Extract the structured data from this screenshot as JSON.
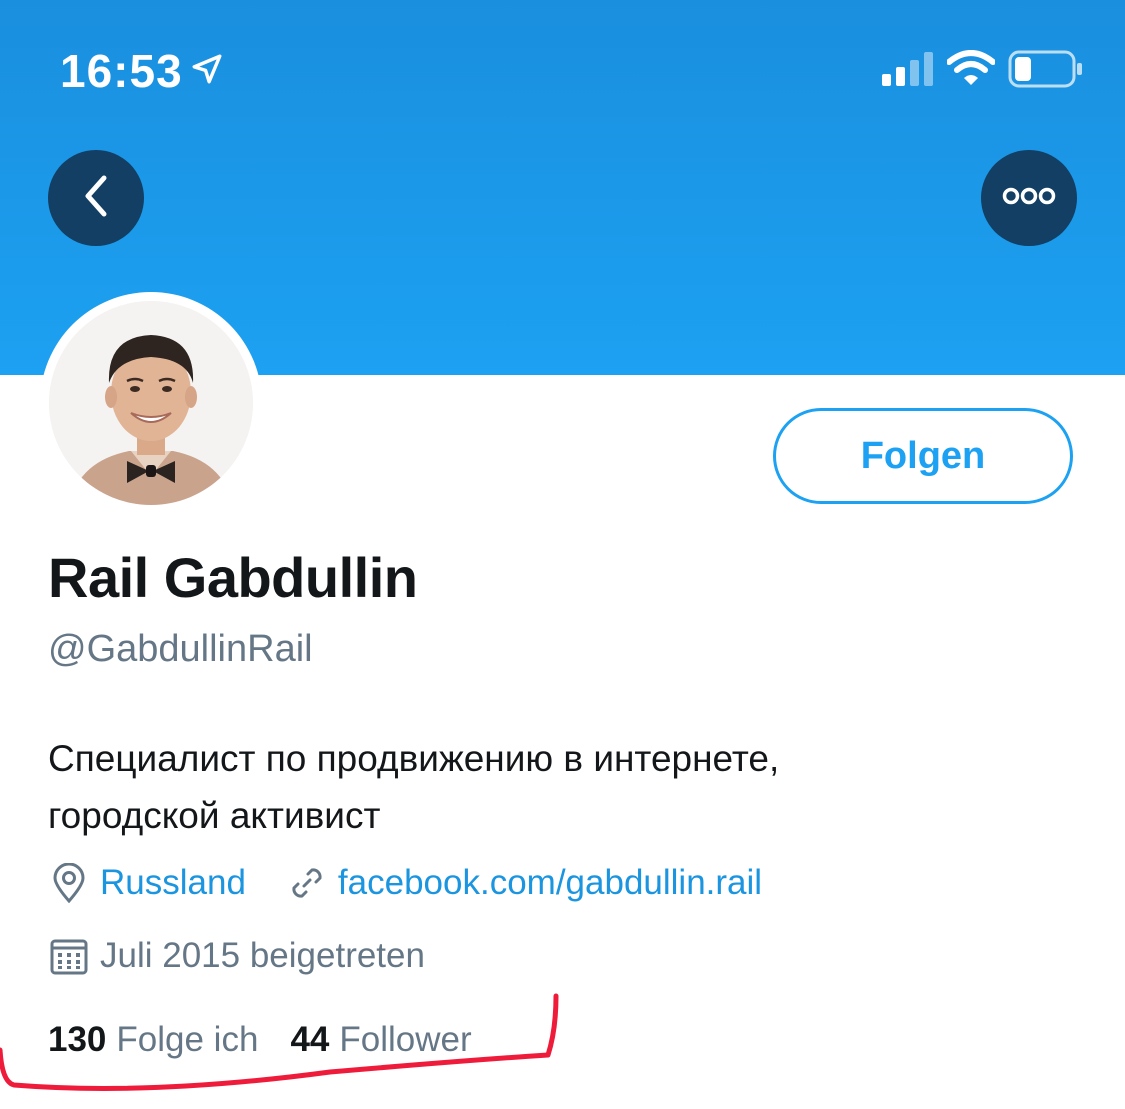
{
  "status_bar": {
    "time": "16:53"
  },
  "colors": {
    "banner": "#1da1f2",
    "nav_button": "#123f63",
    "accent": "#1da1f2",
    "annotation": "#ee1c3a"
  },
  "icons": {
    "back": "chevron-left-icon",
    "more": "more-dots-icon",
    "location": "location-pin-icon",
    "link": "link-icon",
    "calendar": "calendar-icon"
  },
  "profile": {
    "follow_label": "Folgen",
    "name": "Rail Gabdullin",
    "handle": "@GabdullinRail",
    "bio_line1": "Специалист по продвижению в интернете,",
    "bio_line2": "городской активист",
    "location": "Russland",
    "website": "facebook.com/gabdullin.rail",
    "joined": "Juli 2015 beigetreten",
    "following_count": "130",
    "following_label": "Folge ich",
    "followers_count": "44",
    "followers_label": "Follower"
  }
}
